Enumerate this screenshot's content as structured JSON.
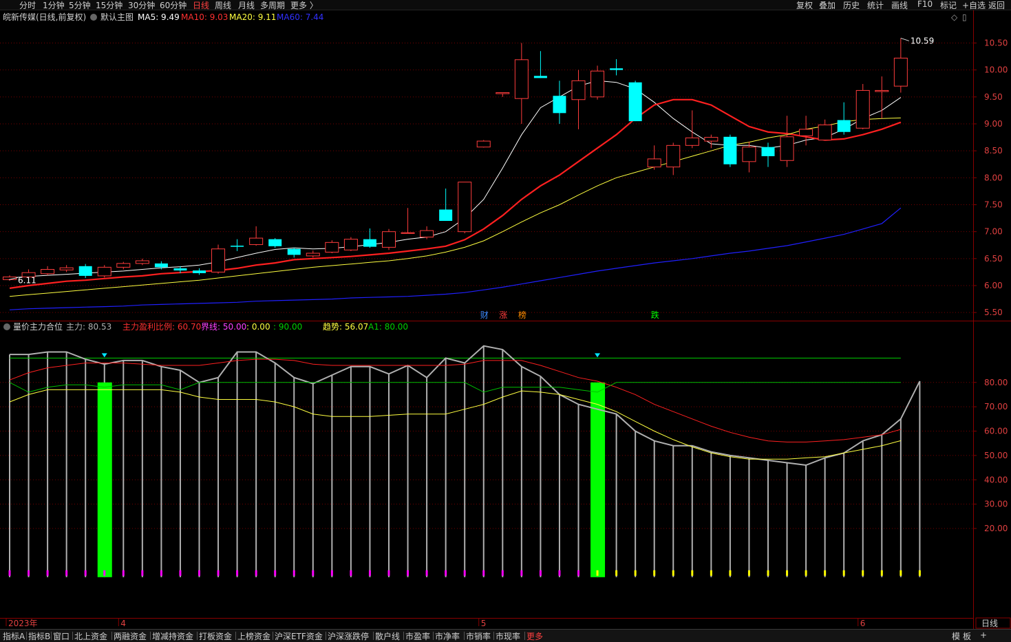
{
  "period_tabs": [
    {
      "label": "分时"
    },
    {
      "label": "1分钟"
    },
    {
      "label": "5分钟"
    },
    {
      "label": "15分钟"
    },
    {
      "label": "30分钟"
    },
    {
      "label": "60分钟"
    },
    {
      "label": "日线",
      "active": true
    },
    {
      "label": "周线"
    },
    {
      "label": "月线"
    },
    {
      "label": "多周期"
    },
    {
      "label": "更多 〉"
    }
  ],
  "right_tools": [
    "复权",
    "叠加",
    "历史",
    "统计",
    "画线",
    "F10",
    "标记",
    "+自选",
    "返回"
  ],
  "main_header": {
    "stock": "皖新传媒(日线,前复权)",
    "template": "默认主图",
    "ma5": "MA5: 9.49",
    "ma10": "MA10: 9.03",
    "ma20": "MA20: 9.11",
    "ma60": "MA60: 7.44"
  },
  "indicator_header": {
    "name": "量价主力合位",
    "zhuli": "主力: 80.53",
    "ratio": "主力盈利比例: 60.70",
    "jiexian": "界线: 50.00",
    "zero": ": 0.00",
    "ninety": ": 90.00",
    "trend": "趋势: 56.07",
    "a1": "A1: 80.00"
  },
  "bottom_tabs": [
    "指标A",
    "指标B",
    "窗口",
    "北上资金",
    "两融资金",
    "增减持资金",
    "打板资金",
    "上榜资金",
    "沪深ETF资金",
    "沪深涨跌停",
    "散户线",
    "市盈率",
    "市净率",
    "市销率",
    "市现率",
    "更多"
  ],
  "bottom_right": [
    "模",
    "板",
    "+"
  ],
  "period_label": "日线",
  "colors": {
    "up": "#ff3c3c",
    "down": "#00ffff",
    "ma5": "#ffffff",
    "ma10": "#ff2020",
    "ma20": "#ffff40",
    "ma60": "#2020ff",
    "green": "#00ff00",
    "magenta": "#ff00ff",
    "grid": "#7a0000"
  },
  "chart_data": [
    {
      "type": "candlestick",
      "title": "皖新传媒(日线,前复权)",
      "ylim": [
        5.4,
        10.8
      ],
      "y_ticks": [
        "10.50",
        "10.00",
        "9.50",
        "9.00",
        "8.50",
        "8.00",
        "7.50",
        "7.00",
        "6.50",
        "6.00",
        "5.50"
      ],
      "max_label": "10.59",
      "min_label": "6.11",
      "x_labels": [
        {
          "label": "2023年",
          "index": 0
        },
        {
          "label": "4",
          "index": 6
        },
        {
          "label": "5",
          "index": 25
        },
        {
          "label": "6",
          "index": 45
        }
      ],
      "event_tags": [
        {
          "label": "财",
          "index": 25,
          "color": "#3a8cff"
        },
        {
          "label": "涨",
          "index": 26,
          "color": "#ff3c3c"
        },
        {
          "label": "榜",
          "index": 27,
          "color": "#ff8c00"
        },
        {
          "label": "跌",
          "index": 34,
          "color": "#00ff00"
        }
      ],
      "candles": [
        [
          6.11,
          6.16,
          6.19,
          6.09
        ],
        [
          6.16,
          6.24,
          6.3,
          6.13
        ],
        [
          6.22,
          6.3,
          6.36,
          6.19
        ],
        [
          6.29,
          6.33,
          6.38,
          6.25
        ],
        [
          6.36,
          6.18,
          6.4,
          6.14
        ],
        [
          6.18,
          6.34,
          6.38,
          6.15
        ],
        [
          6.34,
          6.41,
          6.44,
          6.3
        ],
        [
          6.41,
          6.46,
          6.5,
          6.38
        ],
        [
          6.41,
          6.34,
          6.45,
          6.3
        ],
        [
          6.32,
          6.28,
          6.36,
          6.23
        ],
        [
          6.28,
          6.23,
          6.32,
          6.2
        ],
        [
          6.25,
          6.68,
          6.76,
          6.22
        ],
        [
          6.74,
          6.72,
          6.86,
          6.64
        ],
        [
          6.76,
          6.88,
          7.1,
          6.74
        ],
        [
          6.86,
          6.73,
          6.88,
          6.7
        ],
        [
          6.68,
          6.57,
          6.7,
          6.52
        ],
        [
          6.55,
          6.6,
          6.65,
          6.52
        ],
        [
          6.62,
          6.8,
          6.84,
          6.6
        ],
        [
          6.66,
          6.86,
          6.9,
          6.64
        ],
        [
          6.86,
          6.72,
          7.06,
          6.7
        ],
        [
          6.71,
          7.0,
          7.05,
          6.66
        ],
        [
          6.98,
          6.98,
          7.44,
          6.98
        ],
        [
          6.9,
          7.02,
          7.1,
          6.86
        ],
        [
          7.41,
          7.2,
          7.8,
          7.2
        ],
        [
          7.0,
          7.92,
          7.92,
          6.97
        ],
        [
          8.57,
          8.68,
          8.7,
          8.56
        ],
        [
          9.56,
          9.58,
          9.56,
          9.5
        ],
        [
          9.47,
          10.19,
          10.5,
          9.0
        ],
        [
          9.89,
          9.85,
          10.35,
          9.85
        ],
        [
          9.52,
          9.2,
          9.8,
          9.0
        ],
        [
          9.45,
          9.8,
          10.0,
          8.9
        ],
        [
          9.5,
          9.98,
          10.08,
          9.45
        ],
        [
          10.03,
          10.0,
          10.2,
          9.9
        ],
        [
          9.77,
          9.05,
          9.8,
          9.05
        ],
        [
          8.2,
          8.35,
          8.6,
          8.15
        ],
        [
          8.2,
          8.6,
          8.65,
          8.05
        ],
        [
          8.6,
          8.74,
          9.25,
          8.55
        ],
        [
          8.68,
          8.75,
          8.8,
          8.55
        ],
        [
          8.76,
          8.25,
          8.8,
          8.2
        ],
        [
          8.3,
          8.57,
          8.67,
          8.1
        ],
        [
          8.57,
          8.4,
          8.65,
          8.2
        ],
        [
          8.32,
          8.76,
          9.15,
          8.2
        ],
        [
          8.78,
          8.9,
          9.15,
          8.6
        ],
        [
          8.7,
          8.98,
          9.08,
          8.7
        ],
        [
          9.07,
          8.85,
          9.4,
          8.8
        ],
        [
          8.92,
          9.62,
          9.74,
          8.9
        ],
        [
          9.6,
          9.62,
          9.88,
          9.1
        ],
        [
          9.7,
          10.22,
          10.59,
          9.58
        ]
      ],
      "series": [
        {
          "name": "MA5",
          "values": [
            6.14,
            6.17,
            6.19,
            6.21,
            6.23,
            6.25,
            6.27,
            6.3,
            6.33,
            6.35,
            6.38,
            6.44,
            6.52,
            6.6,
            6.67,
            6.7,
            6.68,
            6.69,
            6.72,
            6.76,
            6.8,
            6.86,
            6.9,
            7.0,
            7.25,
            7.6,
            8.18,
            8.8,
            9.3,
            9.5,
            9.7,
            9.8,
            9.77,
            9.65,
            9.4,
            9.1,
            8.85,
            8.63,
            8.6,
            8.6,
            8.55,
            8.6,
            8.7,
            8.75,
            8.9,
            9.1,
            9.25,
            9.49
          ]
        },
        {
          "name": "MA10",
          "values": [
            5.95,
            6.0,
            6.04,
            6.08,
            6.1,
            6.13,
            6.16,
            6.18,
            6.22,
            6.24,
            6.26,
            6.28,
            6.32,
            6.38,
            6.42,
            6.48,
            6.5,
            6.52,
            6.54,
            6.57,
            6.6,
            6.64,
            6.68,
            6.73,
            6.85,
            7.05,
            7.3,
            7.6,
            7.85,
            8.05,
            8.3,
            8.55,
            8.8,
            9.1,
            9.35,
            9.45,
            9.45,
            9.35,
            9.15,
            8.95,
            8.85,
            8.82,
            8.76,
            8.7,
            8.72,
            8.8,
            8.9,
            9.03
          ]
        },
        {
          "name": "MA20",
          "values": [
            5.8,
            5.83,
            5.86,
            5.89,
            5.92,
            5.95,
            5.98,
            6.01,
            6.04,
            6.07,
            6.1,
            6.14,
            6.18,
            6.22,
            6.26,
            6.3,
            6.34,
            6.37,
            6.4,
            6.43,
            6.46,
            6.5,
            6.55,
            6.62,
            6.71,
            6.83,
            7.0,
            7.18,
            7.35,
            7.5,
            7.68,
            7.85,
            8.0,
            8.1,
            8.2,
            8.3,
            8.4,
            8.5,
            8.6,
            8.66,
            8.74,
            8.8,
            8.9,
            8.96,
            9.04,
            9.08,
            9.1,
            9.11
          ]
        },
        {
          "name": "MA60",
          "values": [
            5.55,
            5.57,
            5.58,
            5.59,
            5.6,
            5.61,
            5.62,
            5.64,
            5.65,
            5.66,
            5.67,
            5.68,
            5.69,
            5.71,
            5.72,
            5.73,
            5.74,
            5.75,
            5.77,
            5.78,
            5.79,
            5.8,
            5.82,
            5.84,
            5.87,
            5.92,
            5.97,
            6.03,
            6.09,
            6.15,
            6.21,
            6.27,
            6.32,
            6.37,
            6.42,
            6.46,
            6.5,
            6.55,
            6.6,
            6.64,
            6.69,
            6.74,
            6.81,
            6.88,
            6.95,
            7.05,
            7.15,
            7.44
          ]
        }
      ]
    },
    {
      "type": "line",
      "title": "量价主力合位",
      "ylim": [
        -6,
        100
      ],
      "y_ticks": [
        "80.00",
        "70.00",
        "60.00",
        "50.00",
        "40.00",
        "30.00",
        "20.00"
      ],
      "green_bars": [
        {
          "index": 5,
          "from": 0,
          "to": 80
        },
        {
          "index": 31,
          "from": 0,
          "to": 80
        }
      ],
      "markers": [
        5,
        31
      ],
      "series": [
        {
          "name": "主力",
          "values": [
            91.5,
            91.5,
            92.5,
            92.5,
            89.5,
            87.5,
            89,
            89,
            86.5,
            85,
            80,
            82,
            92.5,
            92.5,
            88,
            82,
            79.5,
            83,
            86.5,
            86.5,
            83.5,
            87,
            82,
            90,
            88,
            95,
            93.5,
            86.5,
            82.5,
            75,
            71,
            69,
            67,
            60,
            56,
            54,
            54,
            51.5,
            50,
            49,
            48,
            47,
            46,
            49,
            51,
            56,
            58.5,
            65,
            80.53
          ]
        },
        {
          "name": "主力盈利比例",
          "values": [
            81,
            84,
            86,
            87,
            88,
            88,
            88,
            87.5,
            87,
            87,
            87,
            88,
            89,
            89.5,
            89.5,
            89,
            87.5,
            87,
            87,
            87,
            87,
            87,
            87,
            87,
            87.5,
            89,
            89,
            89,
            87,
            84.5,
            82,
            80.5,
            78,
            75,
            71,
            68,
            65,
            62,
            59.5,
            57.5,
            56,
            55.5,
            55.5,
            56,
            56.5,
            57.5,
            58.5,
            60.7
          ]
        },
        {
          "name": "趋势",
          "values": [
            72,
            75,
            77,
            77,
            77,
            77,
            77,
            77,
            77,
            76,
            74,
            73,
            73,
            73,
            72,
            70,
            67,
            66,
            66,
            66,
            66.5,
            67,
            67,
            67,
            69,
            71,
            74,
            76.5,
            76,
            75,
            73,
            71,
            68,
            64,
            60,
            56.5,
            53.5,
            51,
            49.5,
            48.5,
            48.5,
            48.5,
            49,
            49.5,
            51,
            52.5,
            54,
            56.07
          ]
        },
        {
          "name": "A1",
          "values": [
            80,
            76,
            78,
            79,
            79,
            78,
            79,
            79,
            79,
            77,
            80,
            80,
            80,
            80,
            80,
            80,
            80,
            80,
            80,
            80,
            80,
            80,
            80,
            80,
            80,
            76,
            78,
            78,
            78,
            78,
            77,
            76,
            80,
            80,
            80,
            80,
            80,
            80,
            80,
            80,
            80,
            80,
            80,
            80,
            80,
            80,
            80,
            80
          ]
        }
      ],
      "line_90": 90,
      "marks_bottom": "magenta_first_31_then_yellow"
    }
  ]
}
